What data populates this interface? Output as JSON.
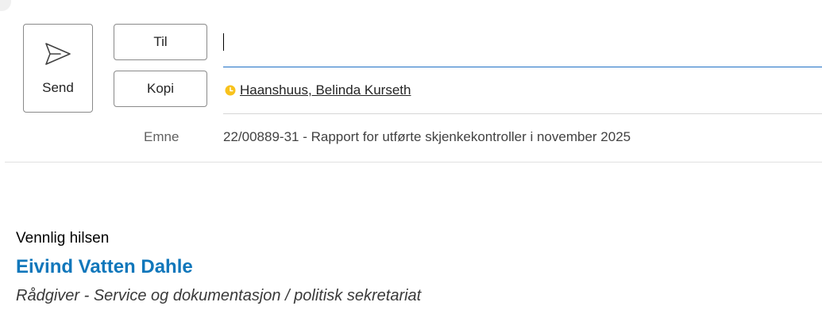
{
  "compose": {
    "send_label": "Send",
    "to_label": "Til",
    "cc_label": "Kopi",
    "to_value": "",
    "cc_recipients": [
      {
        "name": "Haanshuus, Belinda Kurseth",
        "presence": "away",
        "presence_color": "#f8c21c"
      }
    ],
    "subject_label": "Emne",
    "subject_value": "22/00889-31 - Rapport for utførte skjenkekontroller i november 2025"
  },
  "body": {
    "greeting": "Vennlig hilsen",
    "signature_name": "Eivind Vatten Dahle",
    "signature_title": "Rådgiver - Service og dokumentasjon / politisk sekretariat",
    "signature_name_color": "#1177bb"
  },
  "icons": {
    "send": "send-icon",
    "presence": "clock-presence-icon"
  },
  "colors": {
    "focus_underline": "#1f6fc5"
  }
}
